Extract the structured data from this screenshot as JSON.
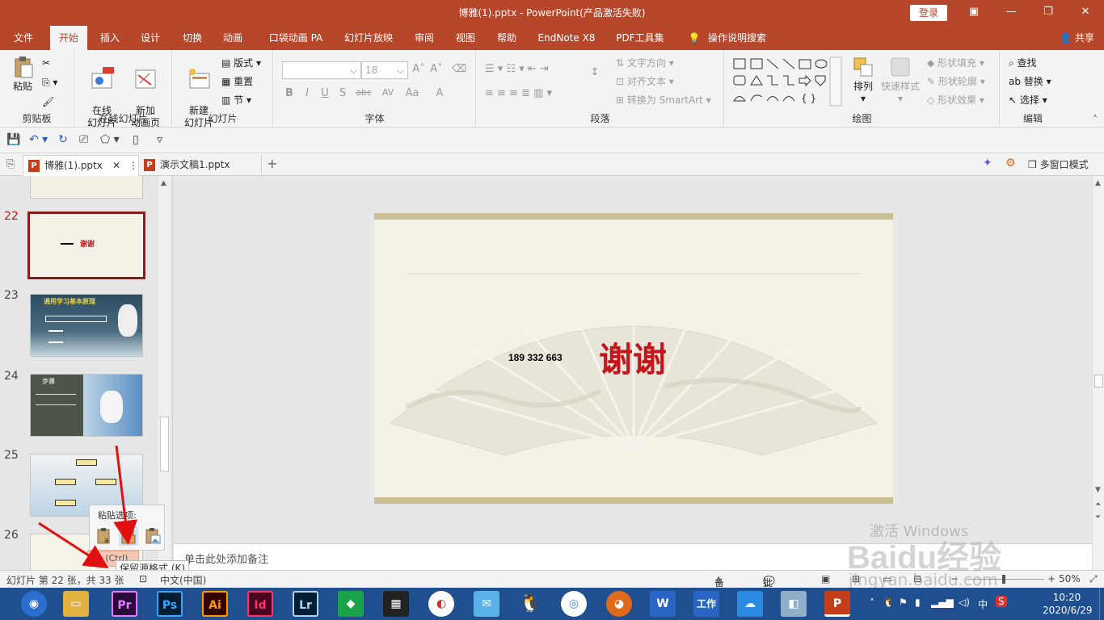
{
  "window": {
    "title": "博雅(1).pptx  -  PowerPoint(产品激活失败)",
    "login_label": "登录"
  },
  "menu": {
    "tabs": [
      "文件",
      "开始",
      "插入",
      "设计",
      "切换",
      "动画",
      "口袋动画 PA",
      "幻灯片放映",
      "审阅",
      "视图",
      "帮助",
      "EndNote X8",
      "PDF工具集",
      "操作说明搜索"
    ],
    "active_index": 1,
    "share_label": "共享"
  },
  "ribbon": {
    "clipboard": {
      "paste": "粘贴",
      "label": "剪贴板"
    },
    "online_slides": {
      "online": "在线\n幻灯片",
      "new_anim": "新加\n动画页",
      "label": "在线幻灯片",
      "hot": "HOT"
    },
    "slides": {
      "new_slide": "新建\n幻灯片",
      "layout": "版式",
      "reset": "重置",
      "section": "节",
      "label": "幻灯片"
    },
    "font": {
      "size": "18",
      "bold": "B",
      "italic": "I",
      "underline": "U",
      "shadow": "S",
      "strike": "abc",
      "spacing": "AV",
      "case": "Aa",
      "color": "A",
      "label": "字体"
    },
    "paragraph": {
      "text_dir": "文字方向",
      "align_text": "对齐文本",
      "smartart": "转换为 SmartArt",
      "label": "段落"
    },
    "drawing": {
      "arrange": "排列",
      "quick_styles": "快速样式",
      "fill": "形状填充",
      "outline": "形状轮廓",
      "effects": "形状效果",
      "label": "绘图"
    },
    "editing": {
      "find": "查找",
      "replace": "替换",
      "select": "选择",
      "label": "编辑"
    }
  },
  "doc_tabs": {
    "tabs": [
      "博雅(1).pptx",
      "演示文稿1.pptx"
    ],
    "multi_window": "多窗口模式"
  },
  "thumbnails": {
    "numbers": [
      "22",
      "23",
      "24",
      "25",
      "26"
    ],
    "slide22_text": "谢谢",
    "slide23_title": "通用学习基本原理",
    "slide24_title": "步骤"
  },
  "slide": {
    "phone": "189  332  663",
    "main_text": "谢谢"
  },
  "notes": {
    "placeholder": "单击此处添加备注"
  },
  "paste_popup": {
    "title": "粘贴选项:",
    "ctrl_badge": "(Ctrl)",
    "tooltip": "保留源格式 (K)"
  },
  "status": {
    "slide_info": "幻灯片 第 22 张，共 33 张",
    "language": "中文(中国)",
    "notes_btn": "备注",
    "comments_btn": "批注",
    "zoom": "50%"
  },
  "taskbar": {
    "apps": [
      "Pr",
      "Ps",
      "Ai",
      "Id",
      "Lr",
      "P"
    ],
    "work_label": "工作",
    "time": "10:20",
    "date": "2020/6/29",
    "ime": "中"
  },
  "watermark": {
    "activate": "激活 Windows",
    "baidu": "Baidu经验",
    "url": "jingyan.baidu.com"
  },
  "colors": {
    "title_red": "#b7472a",
    "slide_red": "#c4161c",
    "taskbar_blue": "#1f4f8f"
  }
}
